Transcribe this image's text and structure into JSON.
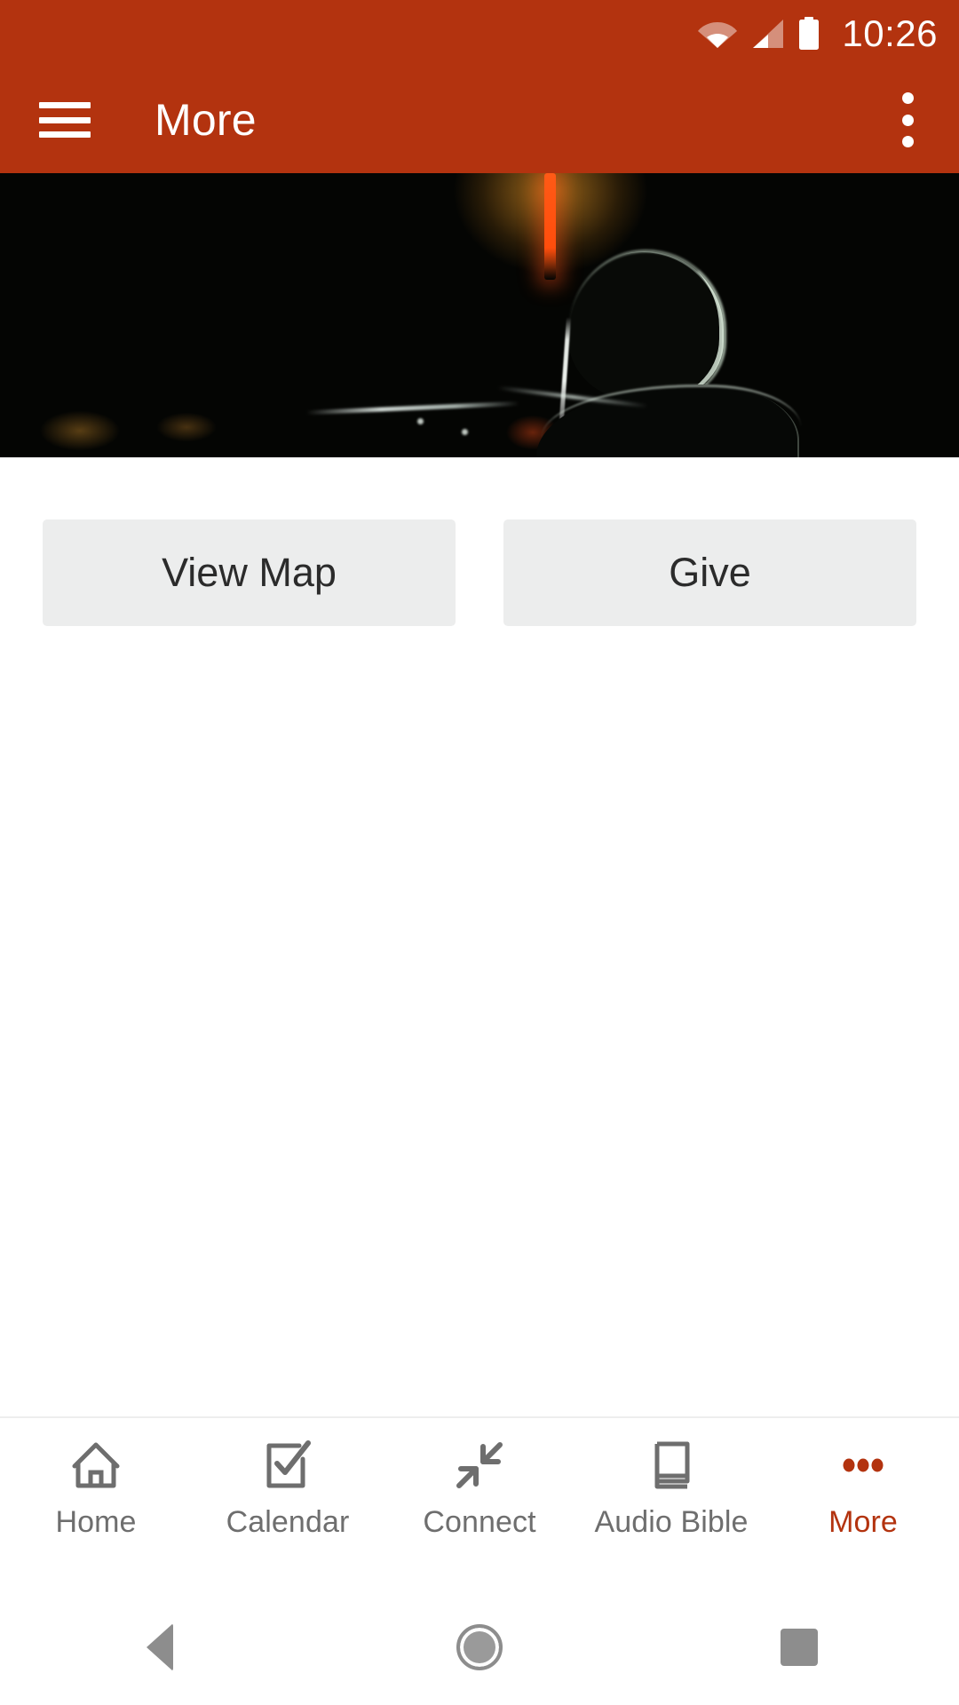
{
  "status_bar": {
    "time": "10:26",
    "icons": [
      "wifi-icon",
      "cellular-signal-icon",
      "battery-icon"
    ],
    "background_color": "#b3330f"
  },
  "app_bar": {
    "menu_icon": "hamburger-menu-icon",
    "title": "More",
    "overflow_icon": "overflow-menu-icon",
    "background_color": "#b3330f",
    "text_color": "#ffffff"
  },
  "hero": {
    "name": "hero-banner-image",
    "description": "Dark concert photograph of a silhouetted person in profile with an orange vertical light beam and amber stage glow",
    "background_color": "#040503",
    "accent_color": "#ff5a16"
  },
  "actions": {
    "buttons": [
      {
        "label": "View Map",
        "name": "view-map-button"
      },
      {
        "label": "Give",
        "name": "give-button"
      }
    ],
    "button_background": "#eceded",
    "button_text_color": "#2b2b2b"
  },
  "tab_bar": {
    "active_color": "#b3330f",
    "inactive_color": "#6e6e6e",
    "items": [
      {
        "label": "Home",
        "icon": "home-icon",
        "active": false
      },
      {
        "label": "Calendar",
        "icon": "calendar-check-icon",
        "active": false
      },
      {
        "label": "Connect",
        "icon": "connect-arrows-icon",
        "active": false
      },
      {
        "label": "Audio Bible",
        "icon": "book-icon",
        "active": false
      },
      {
        "label": "More",
        "icon": "more-dots-icon",
        "active": true
      }
    ]
  },
  "system_nav": {
    "back": "back-triangle-icon",
    "home": "home-circle-icon",
    "recents": "recents-square-icon"
  }
}
